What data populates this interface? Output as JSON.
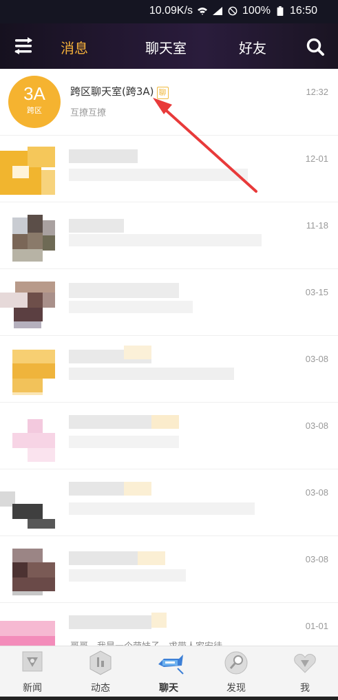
{
  "status_bar": {
    "speed": "10.09K/s",
    "battery": "100%",
    "time": "16:50"
  },
  "header": {
    "tabs": [
      {
        "label": "消息",
        "active": true
      },
      {
        "label": "聊天室",
        "active": false
      },
      {
        "label": "好友",
        "active": false
      }
    ],
    "accent_color": "#f5b13a"
  },
  "conversations": [
    {
      "avatar_top": "3A",
      "avatar_bottom": "跨区",
      "title": "跨区聊天室(跨3A)",
      "tag": "聊",
      "preview": "互撩互撩",
      "time": "12:32"
    },
    {
      "time": "12-01"
    },
    {
      "time": "11-18"
    },
    {
      "time": "03-15"
    },
    {
      "time": "03-08"
    },
    {
      "time": "03-08"
    },
    {
      "time": "03-08"
    },
    {
      "time": "03-08"
    },
    {
      "time": "01-01",
      "preview": "哥哥，我是一个萌妹子，求带人家安徒"
    }
  ],
  "bottom_nav": [
    {
      "label": "新闻",
      "icon": "news-shield-icon",
      "active": false
    },
    {
      "label": "动态",
      "icon": "hexagon-feed-icon",
      "active": false
    },
    {
      "label": "聊天",
      "icon": "chat-rocket-icon",
      "active": true
    },
    {
      "label": "发现",
      "icon": "discover-compass-icon",
      "active": false
    },
    {
      "label": "我",
      "icon": "me-heart-icon",
      "active": false
    }
  ]
}
